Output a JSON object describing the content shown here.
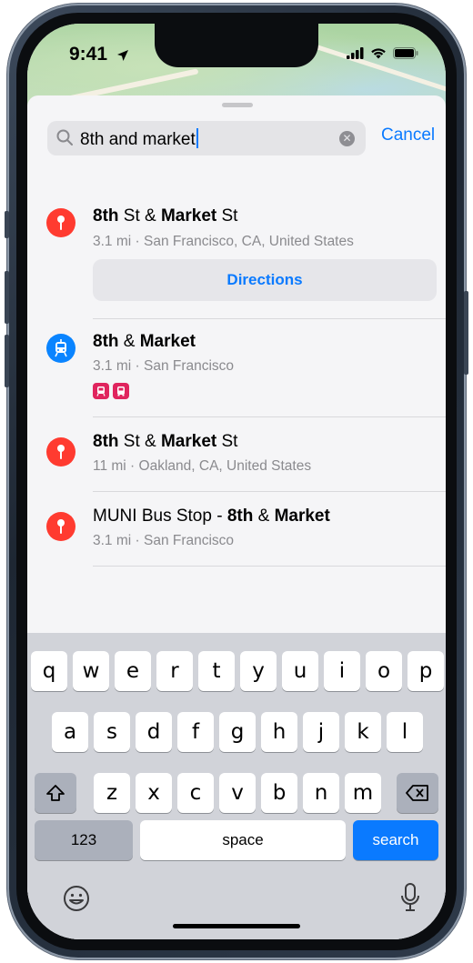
{
  "status": {
    "time": "9:41"
  },
  "search": {
    "query": "8th and market",
    "cancel_label": "Cancel"
  },
  "results": [
    {
      "title_parts": [
        {
          "text": "8th",
          "bold": true
        },
        {
          "text": " St & ",
          "bold": false
        },
        {
          "text": "Market",
          "bold": true
        },
        {
          "text": " St",
          "bold": false
        }
      ],
      "subtitle": "3.1 mi · San Francisco, CA, United States",
      "icon": "map-pin-icon",
      "directions_label": "Directions"
    },
    {
      "title_parts": [
        {
          "text": "8th",
          "bold": true
        },
        {
          "text": " & ",
          "bold": false
        },
        {
          "text": "Market",
          "bold": true
        }
      ],
      "subtitle": "3.1 mi · San Francisco",
      "icon": "tram-icon",
      "badges": [
        "tram-badge-icon",
        "bus-badge-icon"
      ]
    },
    {
      "title_parts": [
        {
          "text": "8th",
          "bold": true
        },
        {
          "text": " St & ",
          "bold": false
        },
        {
          "text": "Market",
          "bold": true
        },
        {
          "text": " St",
          "bold": false
        }
      ],
      "subtitle": "11 mi · Oakland, CA, United States",
      "icon": "map-pin-icon"
    },
    {
      "title_parts": [
        {
          "text": "MUNI Bus Stop ",
          "bold": false
        },
        {
          "text": "- ",
          "bold": false
        },
        {
          "text": "8th",
          "bold": true
        },
        {
          "text": " & ",
          "bold": false
        },
        {
          "text": "Market",
          "bold": true
        }
      ],
      "subtitle": "3.1 mi · San Francisco",
      "icon": "map-pin-icon"
    }
  ],
  "keyboard": {
    "row1": [
      "q",
      "w",
      "e",
      "r",
      "t",
      "y",
      "u",
      "i",
      "o",
      "p"
    ],
    "row2": [
      "a",
      "s",
      "d",
      "f",
      "g",
      "h",
      "j",
      "k",
      "l"
    ],
    "row3": [
      "z",
      "x",
      "c",
      "v",
      "b",
      "n",
      "m"
    ],
    "numbers_label": "123",
    "space_label": "space",
    "search_label": "search"
  },
  "colors": {
    "accent": "#0a7aff",
    "pin_red": "#ff3b30",
    "transit_blue": "#0a84ff",
    "badge_pink": "#e0245e"
  }
}
